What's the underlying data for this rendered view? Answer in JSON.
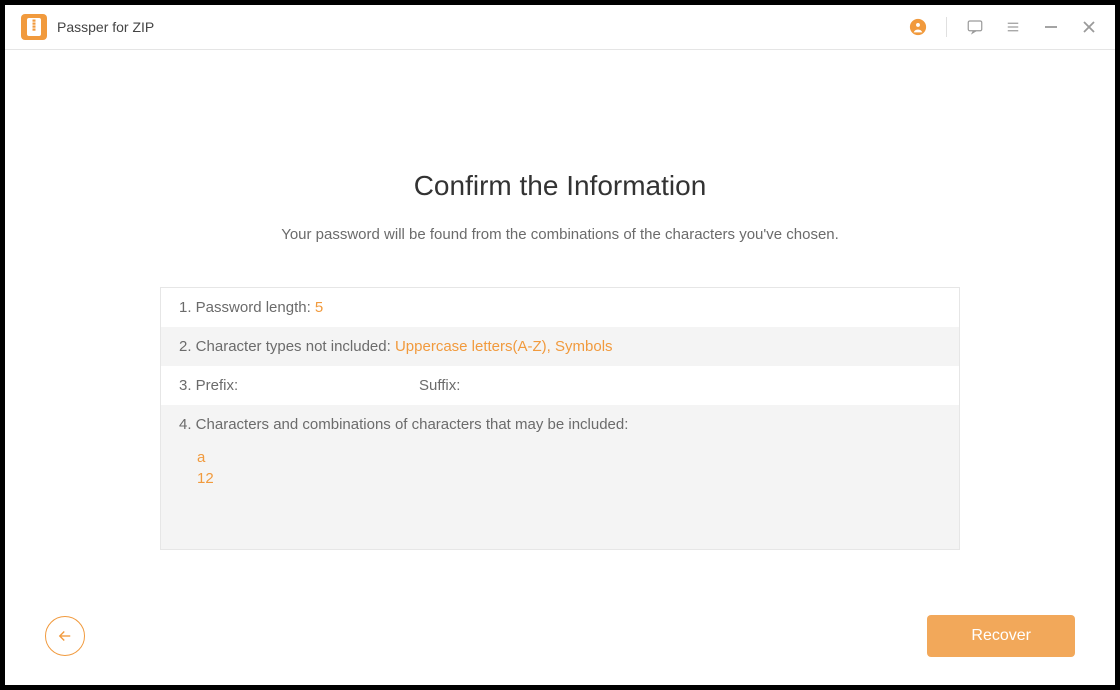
{
  "titlebar": {
    "app_name": "Passper for ZIP"
  },
  "main": {
    "heading": "Confirm the Information",
    "subheading": "Your password will be found from the combinations of the characters you've chosen.",
    "rows": {
      "r1_label": "1. Password length: ",
      "r1_value": "5",
      "r2_label": "2. Character types not included: ",
      "r2_value": "Uppercase letters(A-Z), Symbols",
      "r3_prefix_label": "3. Prefix:",
      "r3_prefix_value": "",
      "r3_suffix_label": "Suffix:",
      "r3_suffix_value": "",
      "r4_label": "4. Characters and combinations of characters that may be included:",
      "r4_line1": "a",
      "r4_line2": "12"
    }
  },
  "footer": {
    "recover_label": "Recover"
  }
}
